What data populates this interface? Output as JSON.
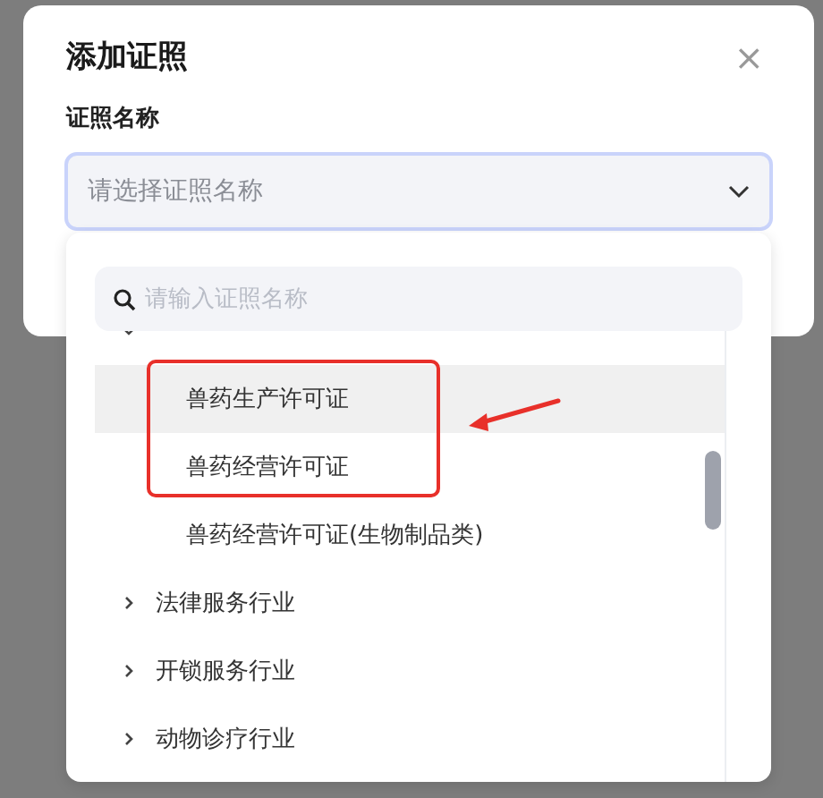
{
  "dialog": {
    "title": "添加证照",
    "close": "×"
  },
  "field": {
    "label": "证照名称",
    "placeholder": "请选择证照名称",
    "open": true
  },
  "dropdown": {
    "search": {
      "placeholder": "请输入证照名称"
    },
    "tree": [
      {
        "expanded": true,
        "children": [
          {
            "label": "兽药生产许可证",
            "selected": true
          },
          {
            "label": "兽药经营许可证",
            "selected": false
          },
          {
            "label": "兽药经营许可证(生物制品类)",
            "selected": false
          }
        ]
      },
      {
        "label": "法律服务行业",
        "expanded": false
      },
      {
        "label": "开锁服务行业",
        "expanded": false
      },
      {
        "label": "动物诊疗行业",
        "expanded": false
      }
    ]
  }
}
